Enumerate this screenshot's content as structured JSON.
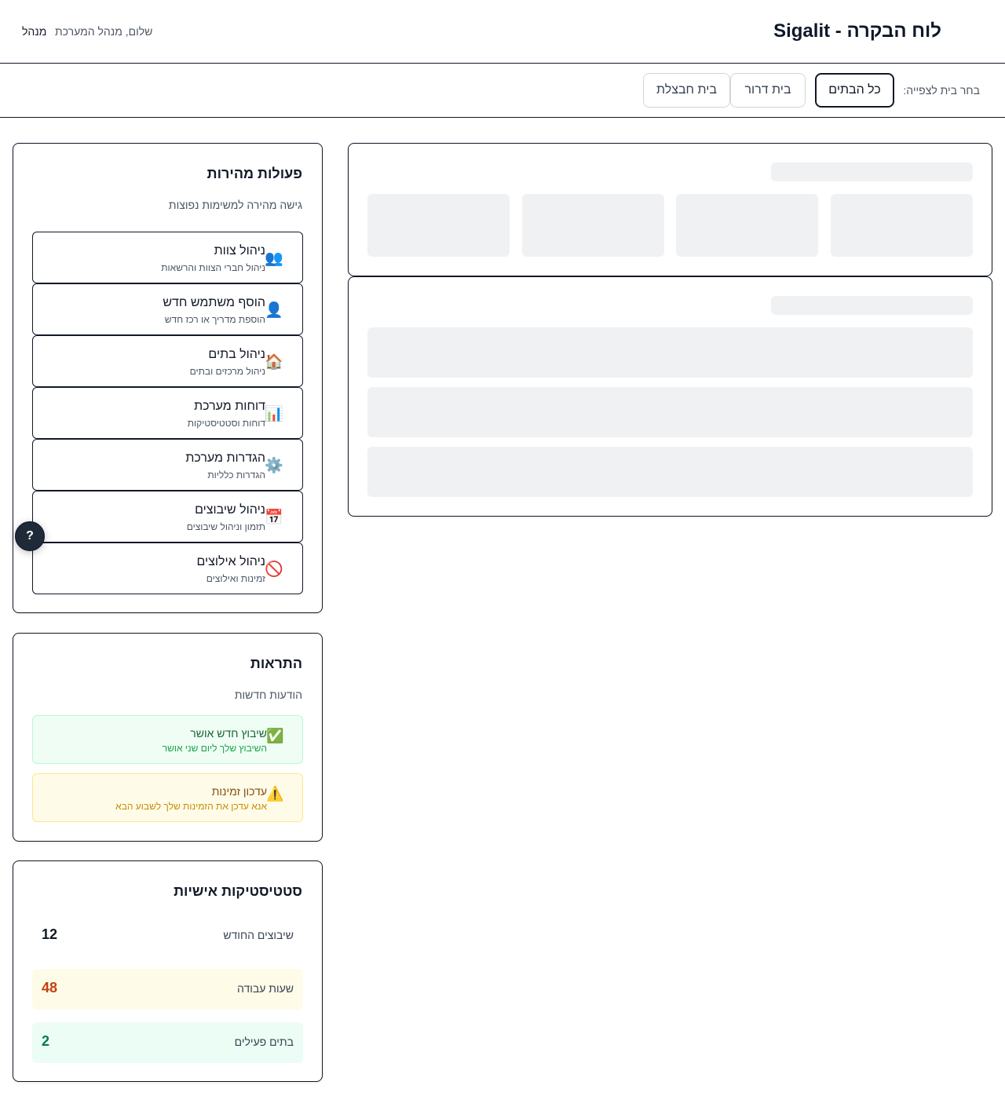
{
  "header": {
    "title": "לוח הבקרה - Sigalit",
    "greeting": "שלום, מנהל המערכת",
    "role": "מנהל"
  },
  "house_selector": {
    "label": "בחר בית לצפייה:",
    "options": [
      {
        "label": "כל הבתים",
        "active": true
      },
      {
        "label": "בית דרור",
        "active": false
      },
      {
        "label": "בית חבצלת",
        "active": false
      }
    ]
  },
  "quick_actions": {
    "title": "פעולות מהירות",
    "subtitle": "גישה מהירה למשימות נפוצות",
    "items": [
      {
        "icon": "team-icon",
        "glyph": "👥",
        "title": "ניהול צוות",
        "desc": "ניהול חברי הצוות והרשאות"
      },
      {
        "icon": "user-icon",
        "glyph": "👤",
        "title": "הוסף משתמש חדש",
        "desc": "הוספת מדריך או רכז חדש"
      },
      {
        "icon": "house-icon",
        "glyph": "🏠",
        "title": "ניהול בתים",
        "desc": "ניהול מרכזים ובתים"
      },
      {
        "icon": "bar-chart-icon",
        "glyph": "📊",
        "title": "דוחות מערכת",
        "desc": "דוחות וסטטיסטיקות"
      },
      {
        "icon": "gear-icon",
        "glyph": "⚙️",
        "title": "הגדרות מערכת",
        "desc": "הגדרות כלליות"
      },
      {
        "icon": "calendar-icon",
        "glyph": "📅",
        "title": "ניהול שיבוצים",
        "desc": "תזמון וניהול שיבוצים"
      },
      {
        "icon": "no-entry-icon",
        "glyph": "🚫",
        "title": "ניהול אילוצים",
        "desc": "זמינות ואילוצים"
      }
    ]
  },
  "alerts": {
    "title": "התראות",
    "subtitle": "הודעות חדשות",
    "items": [
      {
        "icon": "check-icon",
        "glyph": "✅",
        "title": "שיבוץ חדש אושר",
        "desc": "השיבוץ שלך ליום שני אושר",
        "bg": "#f0fdf4",
        "border": "#bbf7d0",
        "title_color": "#166534",
        "desc_color": "#16a34a"
      },
      {
        "icon": "warning-icon",
        "glyph": "⚠️",
        "title": "עדכון זמינות",
        "desc": "אנא עדכן את הזמינות שלך לשבוע הבא",
        "bg": "#fefce8",
        "border": "#fde68a",
        "title_color": "#854d0e",
        "desc_color": "#ca8a04"
      }
    ]
  },
  "stats": {
    "title": "סטטיסטיקות אישיות",
    "items": [
      {
        "label": "שיבוצים החודש",
        "value": "12",
        "bg": "#ffffff",
        "color": "#111827"
      },
      {
        "label": "שעות עבודה",
        "value": "48",
        "bg": "#fefce8",
        "color": "#c2410c"
      },
      {
        "label": "בתים פעילים",
        "value": "2",
        "bg": "#ecfdf5",
        "color": "#047857"
      }
    ]
  },
  "fab": {
    "label": "?"
  }
}
